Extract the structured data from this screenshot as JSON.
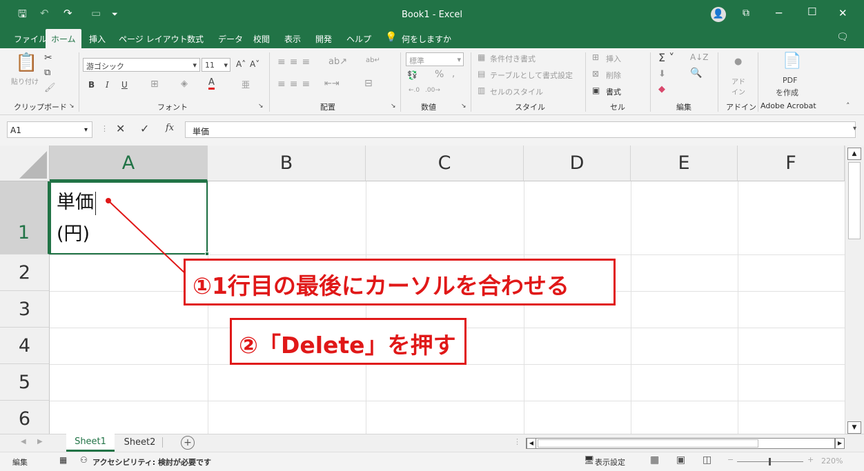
{
  "window": {
    "title": "Book1  -  Excel",
    "minimize": "─",
    "maximize": "☐",
    "close": "✕"
  },
  "ribbon_tabs": [
    "ファイル",
    "ホーム",
    "挿入",
    "ページ レイアウト",
    "数式",
    "データ",
    "校閲",
    "表示",
    "開発",
    "ヘルプ",
    "何をしますか"
  ],
  "ribbon": {
    "clipboard": {
      "label": "クリップボード",
      "paste": "貼り付け"
    },
    "font": {
      "label": "フォント",
      "name": "游ゴシック",
      "size": "11",
      "bold": "B",
      "italic": "I",
      "underline": "U"
    },
    "alignment": {
      "label": "配置"
    },
    "number": {
      "label": "数値",
      "format": "標準",
      "percent": "%"
    },
    "styles": {
      "label": "スタイル",
      "conditional": "条件付き書式",
      "table": "テーブルとして書式設定",
      "cell": "セルのスタイル"
    },
    "cells": {
      "label": "セル",
      "insert": "挿入",
      "delete": "削除",
      "format": "書式"
    },
    "editing": {
      "label": "編集"
    },
    "addins": {
      "label": "アドイン",
      "button": "アド\nイン"
    },
    "acrobat": {
      "label": "Adobe Acrobat",
      "pdf": "PDF",
      "create": "を作成"
    }
  },
  "formula_bar": {
    "name_box": "A1",
    "fx": "fx",
    "content": "単価"
  },
  "sheet": {
    "columns": [
      "A",
      "B",
      "C",
      "D",
      "E",
      "F"
    ],
    "rows": [
      "1",
      "2",
      "3",
      "4",
      "5",
      "6"
    ],
    "cellA1_line1": "単価",
    "cellA1_line2": "(円)"
  },
  "annotations": {
    "step1": "①1行目の最後にカーソルを合わせる",
    "step2": "②「Delete」を押す",
    "color": "#e01818"
  },
  "sheet_tabs": [
    "Sheet1",
    "Sheet2"
  ],
  "status": {
    "mode": "編集",
    "accessibility": "アクセシビリティ: 検討が必要です",
    "display_settings": "表示設定",
    "zoom": "220%"
  },
  "colors": {
    "excel_green": "#217346"
  }
}
